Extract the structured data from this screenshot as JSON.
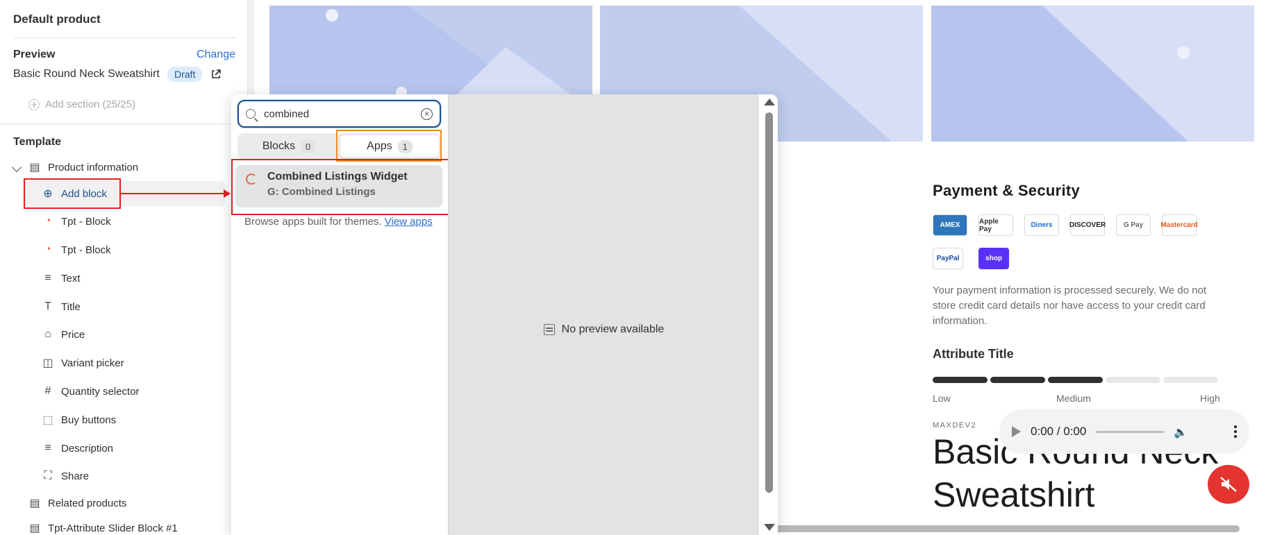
{
  "sidebar": {
    "title": "Default product",
    "preview_label": "Preview",
    "change_label": "Change",
    "preview_product": "Basic Round Neck Sweatshirt",
    "draft_badge": "Draft",
    "add_section": "Add section (25/25)",
    "template_label": "Template",
    "tree": [
      {
        "label": "Product information",
        "icon": "section-icon"
      },
      {
        "label": "Add block",
        "icon": "add-circle-icon"
      },
      {
        "label": "Tpt - Block",
        "icon": "app-block-icon"
      },
      {
        "label": "Tpt - Block",
        "icon": "app-block-icon"
      },
      {
        "label": "Text",
        "icon": "text-icon"
      },
      {
        "label": "Title",
        "icon": "title-icon"
      },
      {
        "label": "Price",
        "icon": "price-tag-icon"
      },
      {
        "label": "Variant picker",
        "icon": "variant-icon"
      },
      {
        "label": "Quantity selector",
        "icon": "hash-icon"
      },
      {
        "label": "Buy buttons",
        "icon": "cursor-icon"
      },
      {
        "label": "Description",
        "icon": "text-icon"
      },
      {
        "label": "Share",
        "icon": "share-icon"
      },
      {
        "label": "Related products",
        "icon": "section-icon"
      },
      {
        "label": "Tpt-Attribute Slider Block #1",
        "icon": "section-icon"
      }
    ]
  },
  "popover": {
    "search_value": "combined",
    "tabs": [
      {
        "label": "Blocks",
        "count": "0"
      },
      {
        "label": "Apps",
        "count": "1"
      }
    ],
    "result": {
      "title": "Combined Listings Widget",
      "subtitle": "G: Combined Listings"
    },
    "browse_text": "Browse apps built for themes.",
    "browse_link": "View apps",
    "no_preview": "No preview available"
  },
  "storefront": {
    "payment_title": "Payment & Security",
    "cards": [
      "AMEX",
      "Apple Pay",
      "Diners",
      "DISCOVER",
      "G Pay",
      "Mastercard",
      "PayPal",
      "shop"
    ],
    "payment_text": "Your payment information is processed securely. We do not store credit card details nor have access to your credit card information.",
    "attribute_title": "Attribute Title",
    "attribute_level": 0.6,
    "scale": [
      "Low",
      "Medium",
      "High"
    ],
    "vendor": "MAXDEV2",
    "product_title": "Basic Round Neck Sweatshirt",
    "audio_time": "0:00 / 0:00"
  },
  "colors": {
    "accent": "#2c6ecb",
    "highlight_red": "#e41c1c",
    "highlight_orange": "#f08c1e",
    "hero": "#c1cdef"
  }
}
